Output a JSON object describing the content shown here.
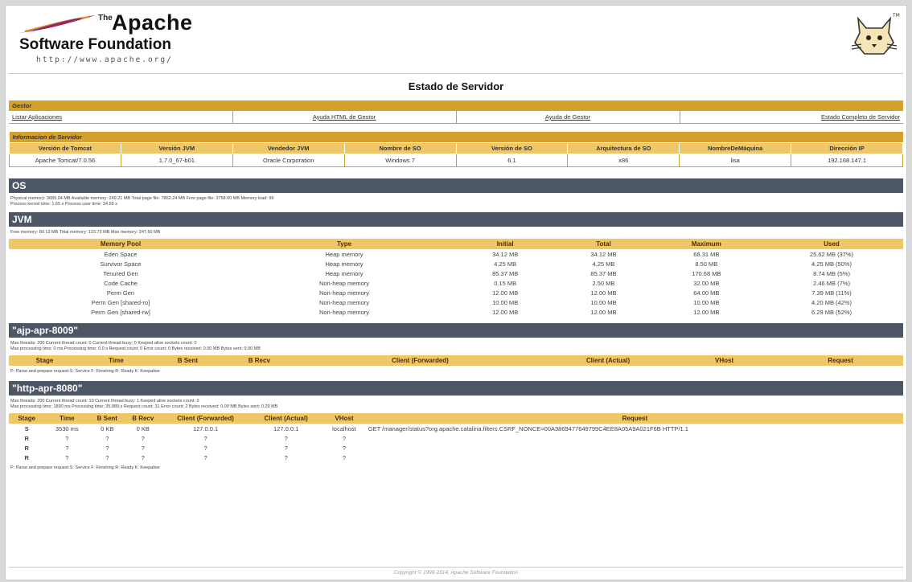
{
  "logo": {
    "the": "The",
    "apache": "Apache",
    "foundation": "Software Foundation",
    "url": "http://www.apache.org/"
  },
  "page_title": "Estado de Servidor",
  "manager": {
    "header": "Gestor",
    "links": [
      "Listar Aplicaciones",
      "Ayuda HTML de Gestor",
      "Ayuda de Gestor",
      "Estado Completo de Servidor"
    ]
  },
  "server_info": {
    "header": "Informacion de Servidor",
    "columns": [
      "Versión de Tomcat",
      "Versión JVM",
      "Vendedor JVM",
      "Nombre de SO",
      "Versión de SO",
      "Arquitectura de SO",
      "NombreDeMáquina",
      "Dirección IP"
    ],
    "values": [
      "Apache Tomcat/7.0.56",
      "1.7.0_67-b01",
      "Oracle Corporation",
      "Windows 7",
      "6.1",
      "x86",
      "lisa",
      "192.168.147.1"
    ]
  },
  "os": {
    "title": "OS",
    "line1": "Physical memory: 3689.04 MB Available memory: 249.21 MB Total page file: 7862.24 MB Free page file: 3758.00 MB Memory load: 96",
    "line2": "Process kernel time: 1.65 s Process user time: 34.65 s"
  },
  "jvm": {
    "title": "JVM",
    "line1": "Free memory: 80.13 MB Total memory: 123.73 MB Max memory: 247.50 MB",
    "columns": [
      "Memory Pool",
      "Type",
      "Initial",
      "Total",
      "Maximum",
      "Used"
    ],
    "rows": [
      [
        "Eden Space",
        "Heap memory",
        "34.12 MB",
        "34.12 MB",
        "68.31 MB",
        "25.62 MB (37%)"
      ],
      [
        "Survivor Space",
        "Heap memory",
        "4.25 MB",
        "4.25 MB",
        "8.50 MB",
        "4.25 MB (50%)"
      ],
      [
        "Tenured Gen",
        "Heap memory",
        "85.37 MB",
        "85.37 MB",
        "170.68 MB",
        "8.74 MB (5%)"
      ],
      [
        "Code Cache",
        "Non-heap memory",
        "0.15 MB",
        "2.50 MB",
        "32.00 MB",
        "2.46 MB (7%)"
      ],
      [
        "Perm Gen",
        "Non-heap memory",
        "12.00 MB",
        "12.00 MB",
        "64.00 MB",
        "7.39 MB (11%)"
      ],
      [
        "Perm Gen [shared-ro]",
        "Non-heap memory",
        "10.00 MB",
        "10.00 MB",
        "10.00 MB",
        "4.20 MB (42%)"
      ],
      [
        "Perm Gen [shared-rw]",
        "Non-heap memory",
        "12.00 MB",
        "12.00 MB",
        "12.00 MB",
        "6.29 MB (52%)"
      ]
    ]
  },
  "ajp": {
    "title": "\"ajp-apr-8009\"",
    "line1": "Max threads: 200 Current thread count: 0 Current thread busy: 0 Keeped alive sockets count: 0",
    "line2": "Max processing time: 0 ms Processing time: 0.0 s Request count: 0 Error count: 0 Bytes received: 0.00 MB Bytes sent: 0.00 MB",
    "columns": [
      "Stage",
      "Time",
      "B Sent",
      "B Recv",
      "Client (Forwarded)",
      "Client (Actual)",
      "VHost",
      "Request"
    ],
    "legend": "P: Parse and prepare request S: Service F: Finishing R: Ready K: Keepalive"
  },
  "http": {
    "title": "\"http-apr-8080\"",
    "line1": "Max threads: 200 Current thread count: 10 Current thread busy: 1 Keeped alive sockets count: 0",
    "line2": "Max processing time: 1890 ms Processing time: 35.889 s Request count: 31 Error count: 2 Bytes received: 0.00 MB Bytes sent: 0.29 MB",
    "columns": [
      "Stage",
      "Time",
      "B Sent",
      "B Recv",
      "Client (Forwarded)",
      "Client (Actual)",
      "VHost",
      "Request"
    ],
    "rows": [
      [
        "S",
        "3530 ms",
        "0 KB",
        "0 KB",
        "127.0.0.1",
        "127.0.0.1",
        "localhost",
        "GET /manager/status?org.apache.catalina.filters.CSRF_NONCE=00A3869477649799C4EE8A05A9A021F6B HTTP/1.1"
      ],
      [
        "R",
        "?",
        "?",
        "?",
        "?",
        "?",
        "?",
        ""
      ],
      [
        "R",
        "?",
        "?",
        "?",
        "?",
        "?",
        "?",
        ""
      ],
      [
        "R",
        "?",
        "?",
        "?",
        "?",
        "?",
        "?",
        ""
      ]
    ],
    "legend": "P: Parse and prepare request S: Service F: Finishing R: Ready K: Keepalive"
  },
  "footer": "Copyright © 1999-2014, Apache Software Foundation",
  "colors": {
    "gold": "#d4a12d",
    "light_gold": "#f0c766",
    "section": "#4d5665"
  }
}
